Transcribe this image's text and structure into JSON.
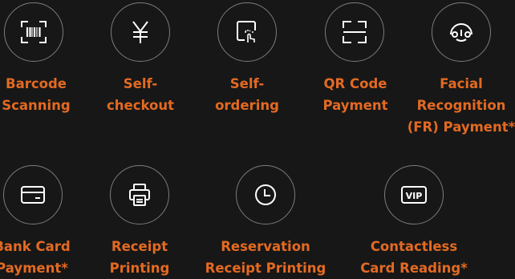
{
  "features": [
    {
      "icon": "barcode-icon",
      "lines": [
        "Barcode",
        "Scanning"
      ]
    },
    {
      "icon": "yen-icon",
      "lines": [
        "Self-",
        "checkout"
      ]
    },
    {
      "icon": "touch-screen-icon",
      "lines": [
        "Self-",
        "ordering"
      ]
    },
    {
      "icon": "qr-scan-icon",
      "lines": [
        "QR Code",
        "Payment"
      ]
    },
    {
      "icon": "face-icon",
      "lines": [
        "Facial",
        "Recognition",
        "(FR) Payment*"
      ]
    },
    {
      "icon": "bank-card-icon",
      "lines": [
        "Bank Card",
        "Payment*"
      ]
    },
    {
      "icon": "printer-icon",
      "lines": [
        "Receipt",
        "Printing"
      ]
    },
    {
      "icon": "clock-icon",
      "lines": [
        "Reservation",
        "Receipt Printing"
      ]
    },
    {
      "icon": "vip-card-icon",
      "vip_text": "VIP",
      "lines": [
        "Contactless",
        "Card Reading*"
      ]
    }
  ],
  "colors": {
    "background": "#171717",
    "accent": "#e36a22",
    "circle_border": "#7c7c7c",
    "icon": "#ffffff"
  }
}
